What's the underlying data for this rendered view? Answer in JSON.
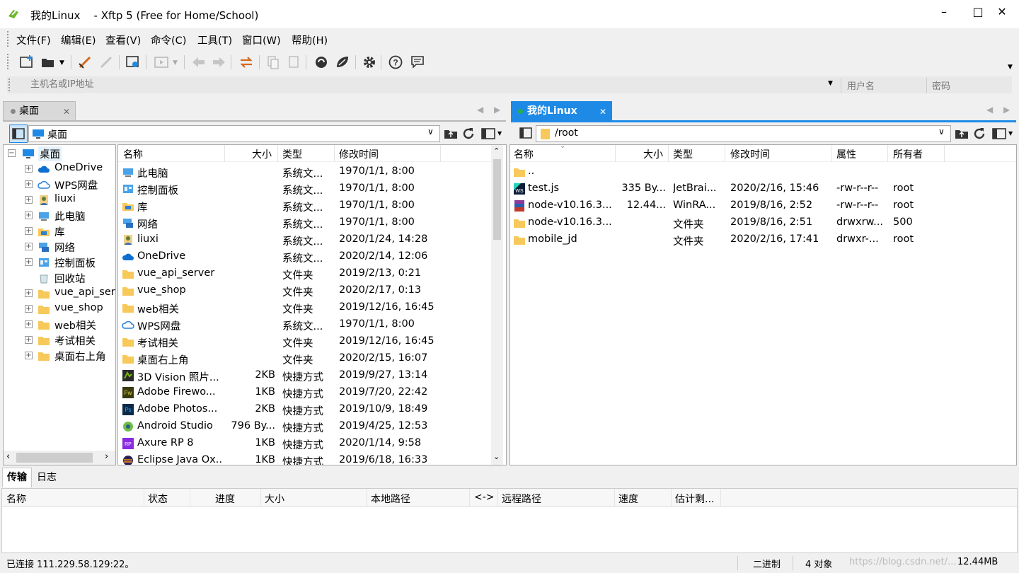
{
  "window": {
    "title_session": "我的Linux",
    "title_app": "Xftp 5 (Free for Home/School)"
  },
  "menu": [
    "文件(F)",
    "编辑(E)",
    "查看(V)",
    "命令(C)",
    "工具(T)",
    "窗口(W)",
    "帮助(H)"
  ],
  "address": {
    "host_placeholder": "主机名或IP地址",
    "user_placeholder": "用户名",
    "password_placeholder": "密码"
  },
  "left": {
    "tab": "桌面",
    "path": "桌面",
    "tree": [
      {
        "label": "桌面",
        "icon": "desktop",
        "level": 0
      },
      {
        "label": "OneDrive",
        "icon": "cloud",
        "level": 1
      },
      {
        "label": "WPS网盘",
        "icon": "cloud-outline",
        "level": 1
      },
      {
        "label": "liuxi",
        "icon": "user",
        "level": 1
      },
      {
        "label": "此电脑",
        "icon": "computer",
        "level": 1
      },
      {
        "label": "库",
        "icon": "library",
        "level": 1
      },
      {
        "label": "网络",
        "icon": "network",
        "level": 1
      },
      {
        "label": "控制面板",
        "icon": "control-panel",
        "level": 1
      },
      {
        "label": "回收站",
        "icon": "recycle-bin",
        "level": 1
      },
      {
        "label": "vue_api_server",
        "icon": "folder",
        "level": 1
      },
      {
        "label": "vue_shop",
        "icon": "folder",
        "level": 1
      },
      {
        "label": "web相关",
        "icon": "folder",
        "level": 1
      },
      {
        "label": "考试相关",
        "icon": "folder",
        "level": 1
      },
      {
        "label": "桌面右上角",
        "icon": "folder",
        "level": 1
      }
    ],
    "columns": [
      "名称",
      "大小",
      "类型",
      "修改时间"
    ],
    "files": [
      {
        "name": "此电脑",
        "size": "",
        "type": "系统文...",
        "modified": "1970/1/1, 8:00",
        "icon": "computer"
      },
      {
        "name": "控制面板",
        "size": "",
        "type": "系统文...",
        "modified": "1970/1/1, 8:00",
        "icon": "control-panel"
      },
      {
        "name": "库",
        "size": "",
        "type": "系统文...",
        "modified": "1970/1/1, 8:00",
        "icon": "library"
      },
      {
        "name": "网络",
        "size": "",
        "type": "系统文...",
        "modified": "1970/1/1, 8:00",
        "icon": "network"
      },
      {
        "name": "liuxi",
        "size": "",
        "type": "系统文...",
        "modified": "2020/1/24, 14:28",
        "icon": "user"
      },
      {
        "name": "OneDrive",
        "size": "",
        "type": "系统文...",
        "modified": "2020/2/14, 12:06",
        "icon": "cloud"
      },
      {
        "name": "vue_api_server",
        "size": "",
        "type": "文件夹",
        "modified": "2019/2/13, 0:21",
        "icon": "folder"
      },
      {
        "name": "vue_shop",
        "size": "",
        "type": "文件夹",
        "modified": "2020/2/17, 0:13",
        "icon": "folder"
      },
      {
        "name": "web相关",
        "size": "",
        "type": "文件夹",
        "modified": "2019/12/16, 16:45",
        "icon": "folder"
      },
      {
        "name": "WPS网盘",
        "size": "",
        "type": "系统文...",
        "modified": "1970/1/1, 8:00",
        "icon": "cloud-outline"
      },
      {
        "name": "考试相关",
        "size": "",
        "type": "文件夹",
        "modified": "2019/12/16, 16:45",
        "icon": "folder"
      },
      {
        "name": "桌面右上角",
        "size": "",
        "type": "文件夹",
        "modified": "2020/2/15, 16:07",
        "icon": "folder"
      },
      {
        "name": "3D Vision 照片...",
        "size": "2KB",
        "type": "快捷方式",
        "modified": "2019/9/27, 13:14",
        "icon": "shortcut-3d"
      },
      {
        "name": "Adobe Firewo...",
        "size": "1KB",
        "type": "快捷方式",
        "modified": "2019/7/20, 22:42",
        "icon": "shortcut-fw"
      },
      {
        "name": "Adobe Photos...",
        "size": "2KB",
        "type": "快捷方式",
        "modified": "2019/10/9, 18:49",
        "icon": "shortcut-ps"
      },
      {
        "name": "Android Studio",
        "size": "796 By...",
        "type": "快捷方式",
        "modified": "2019/4/25, 12:53",
        "icon": "shortcut-android"
      },
      {
        "name": "Axure RP 8",
        "size": "1KB",
        "type": "快捷方式",
        "modified": "2020/1/14, 9:58",
        "icon": "shortcut-axure"
      },
      {
        "name": "Eclipse Java Ox...",
        "size": "1KB",
        "type": "快捷方式",
        "modified": "2019/6/18, 16:33",
        "icon": "shortcut-eclipse"
      }
    ]
  },
  "right": {
    "tab": "我的Linux",
    "path": "/root",
    "columns": [
      "名称",
      "大小",
      "类型",
      "修改时间",
      "属性",
      "所有者"
    ],
    "files": [
      {
        "name": "..",
        "size": "",
        "type": "",
        "modified": "",
        "attr": "",
        "owner": "",
        "icon": "folder"
      },
      {
        "name": "test.js",
        "size": "335 By...",
        "type": "JetBrai...",
        "modified": "2020/2/16, 15:46",
        "attr": "-rw-r--r--",
        "owner": "root",
        "icon": "webstorm"
      },
      {
        "name": "node-v10.16.3...",
        "size": "12.44...",
        "type": "WinRA...",
        "modified": "2019/8/16, 2:52",
        "attr": "-rw-r--r--",
        "owner": "root",
        "icon": "winrar"
      },
      {
        "name": "node-v10.16.3...",
        "size": "",
        "type": "文件夹",
        "modified": "2019/8/16, 2:51",
        "attr": "drwxrw...",
        "owner": "500",
        "icon": "folder"
      },
      {
        "name": "mobile_jd",
        "size": "",
        "type": "文件夹",
        "modified": "2020/2/16, 17:41",
        "attr": "drwxr-...",
        "owner": "root",
        "icon": "folder"
      }
    ]
  },
  "bottom": {
    "tabs": [
      "传输",
      "日志"
    ],
    "columns": [
      "名称",
      "状态",
      "进度",
      "大小",
      "本地路径",
      "<->",
      "远程路径",
      "速度",
      "估计剩..."
    ]
  },
  "status": {
    "connection": "已连接 111.229.58.129:22。",
    "mode": "二进制",
    "objects": "4 对象",
    "size": "12.44MB",
    "watermark": "https://blog.csdn.net/..."
  },
  "colors": {
    "accent": "#1e8ae6",
    "folder": "#f7c95a",
    "session_dot": "#22b14c"
  }
}
